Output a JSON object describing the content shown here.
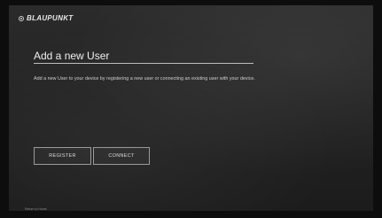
{
  "brand": {
    "logo_text": "BLAUPUNKT",
    "logo_icon": "blaupunkt-dot-logo-icon"
  },
  "page": {
    "title": "Add a new User",
    "description": "Add a new User to your device by registering a new user or connecting an existing user with your device."
  },
  "actions": {
    "register_label": "REGISTER",
    "connect_label": "CONNECT"
  },
  "footer": {
    "text": "Return to Home"
  },
  "colors": {
    "background": "#232323",
    "text": "#f0f0f0",
    "button_border": "#9a9a9a"
  }
}
